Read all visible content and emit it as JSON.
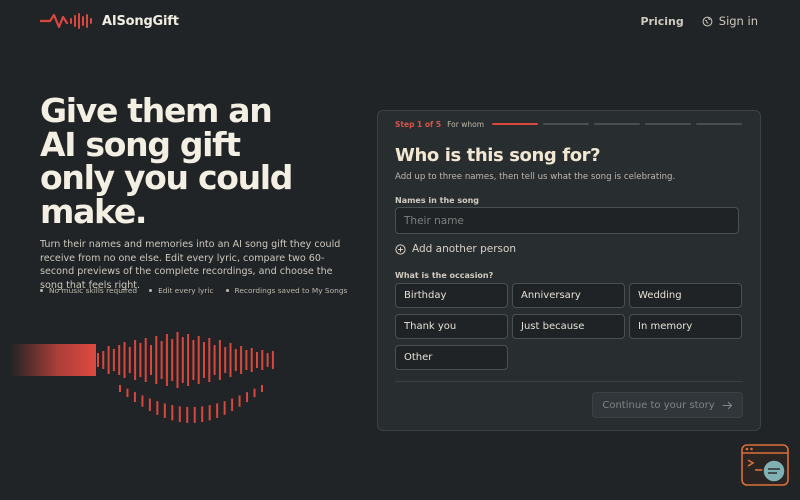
{
  "header": {
    "brand": "AISongGift",
    "nav_pricing": "Pricing",
    "nav_signin": "Sign in"
  },
  "hero": {
    "title_lines": [
      "Give them an",
      "AI song gift",
      "only you could",
      "make."
    ],
    "description": "Turn their names and memories into an AI song gift they could receive from no one else. Edit every lyric, compare two 60-second previews of the complete recordings, and choose the song that feels right.",
    "bullets": [
      "No music skills required",
      "Edit every lyric",
      "Recordings saved to My Songs"
    ]
  },
  "form": {
    "step_count": "Step 1 of 5",
    "step_name": "For whom",
    "progress": {
      "current_step": 1,
      "total_steps": 5
    },
    "title": "Who is this song for?",
    "subtitle": "Add up to three names, then tell us what the song is celebrating.",
    "names_label": "Names in the song",
    "name_placeholder": "Their name",
    "add_person": "Add another person",
    "occasion_label": "What is the occasion?",
    "occasions": [
      "Birthday",
      "Anniversary",
      "Wedding",
      "Thank you",
      "Just because",
      "In memory",
      "Other"
    ],
    "continue_label": "Continue to your story"
  },
  "colors": {
    "accent": "#d9473f",
    "background": "#202426",
    "card": "#282d2f",
    "heading": "#f4efe3"
  },
  "icons": [
    "logo-wave-icon",
    "globe-icon",
    "plus-circle-icon",
    "arrow-right-icon",
    "waveform-graphic",
    "help-widget-icon"
  ]
}
